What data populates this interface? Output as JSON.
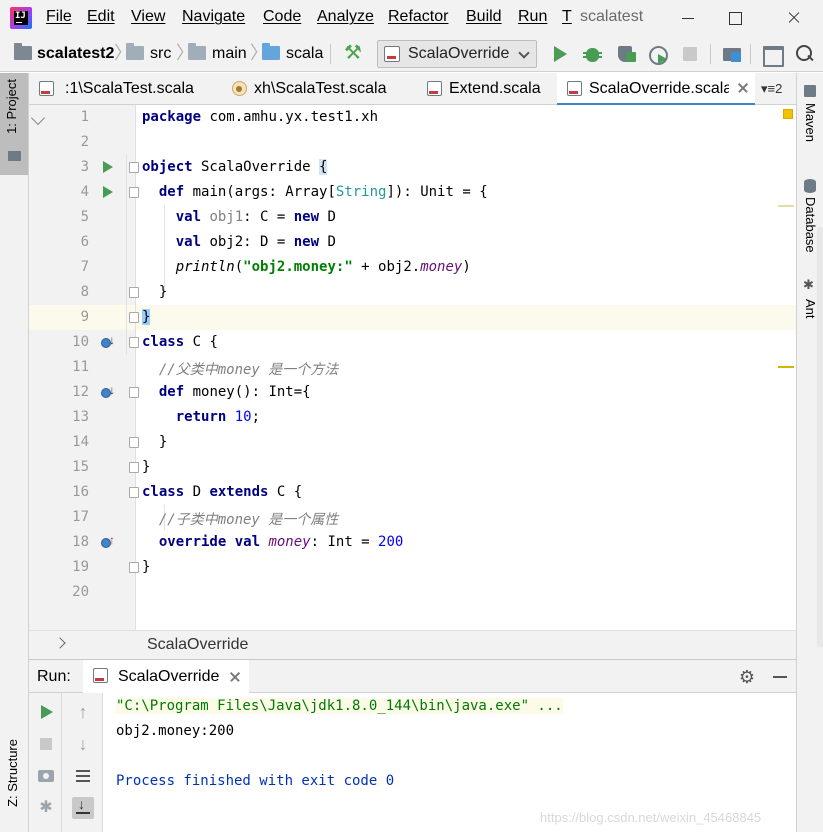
{
  "menubar": {
    "logo_text": "IJ",
    "items": [
      "File",
      "Edit",
      "View",
      "Navigate",
      "Code",
      "Analyze",
      "Refactor",
      "Build",
      "Run",
      "T"
    ],
    "window_title": "scalatest"
  },
  "navbar": {
    "breadcrumbs": [
      "scalatest2",
      "src",
      "main",
      "scala"
    ],
    "run_config": "ScalaOverride"
  },
  "left_stripe": {
    "project_label": "1: Project",
    "structure_label": "Z: Structure"
  },
  "right_stripe": {
    "tools": [
      "Maven",
      "Database",
      "Ant"
    ]
  },
  "tabs": {
    "items": [
      {
        "title": ":1\\ScalaTest.scala",
        "active": false
      },
      {
        "title": "xh\\ScalaTest.scala",
        "active": false
      },
      {
        "title": "Extend.scala",
        "active": false
      },
      {
        "title": "ScalaOverride.scala",
        "active": true
      }
    ],
    "overflow": "▾≡2"
  },
  "editor": {
    "current_line": 9,
    "lines": [
      {
        "n": "1"
      },
      {
        "n": "2"
      },
      {
        "n": "3"
      },
      {
        "n": "4"
      },
      {
        "n": "5"
      },
      {
        "n": "6"
      },
      {
        "n": "7"
      },
      {
        "n": "8"
      },
      {
        "n": "9"
      },
      {
        "n": "10"
      },
      {
        "n": "11"
      },
      {
        "n": "12"
      },
      {
        "n": "13"
      },
      {
        "n": "14"
      },
      {
        "n": "15"
      },
      {
        "n": "16"
      },
      {
        "n": "17"
      },
      {
        "n": "18"
      },
      {
        "n": "19"
      },
      {
        "n": "20"
      }
    ],
    "code": {
      "l1_kw": "package",
      "l1_rest": " com.amhu.yx.test1.xh",
      "l3_kw": "object",
      "l3_rest": " ScalaOverride ",
      "l3_brace": "{",
      "l4_indent": "  ",
      "l4_kw": "def",
      "l4_a": " main(args: Array",
      "l4_b1": "[",
      "l4_type": "String",
      "l4_b2": "]",
      "l4_c": "): Unit = {",
      "l5_indent": "    ",
      "l5_kw": "val",
      "l5_var": " obj1",
      "l5_a": ": C = ",
      "l5_kw2": "new",
      "l5_b": " D",
      "l6_indent": "    ",
      "l6_kw": "val",
      "l6_a": " obj2: D = ",
      "l6_kw2": "new",
      "l6_b": " D",
      "l7_indent": "    ",
      "l7_fn": "println",
      "l7_a": "(",
      "l7_str": "\"obj2.money:\"",
      "l7_b": " + obj2.",
      "l7_field": "money",
      "l7_c": ")",
      "l8": "  }",
      "l9": "}",
      "l10_kw": "class",
      "l10_rest": " C {",
      "l11_indent": "  ",
      "l11_cmt": "//父类中money 是一个方法",
      "l12_indent": "  ",
      "l12_kw": "def",
      "l12_rest": " money(): Int={",
      "l13_indent": "    ",
      "l13_kw": "return",
      "l13_sp": " ",
      "l13_num": "10",
      "l13_end": ";",
      "l14": "  }",
      "l15": "}",
      "l16_kw": "class",
      "l16_a": " D ",
      "l16_kw2": "extends",
      "l16_b": " C {",
      "l17_indent": "  ",
      "l17_cmt": "//子类中money 是一个属性",
      "l18_indent": "  ",
      "l18_kw": "override val",
      "l18_sp": " ",
      "l18_field": "money",
      "l18_a": ": Int = ",
      "l18_num": "200",
      "l19": "}"
    }
  },
  "breadcrumb_bar": {
    "text": "ScalaOverride"
  },
  "run_window": {
    "label": "Run:",
    "tab_title": "ScalaOverride",
    "console": {
      "command": "\"C:\\Program Files\\Java\\jdk1.8.0_144\\bin\\java.exe\" ...",
      "output": "obj2.money:200",
      "exit": "Process finished with exit code 0"
    }
  },
  "watermark": "https://blog.csdn.net/weixin_45468845",
  "colors": {
    "keyword": "#000080",
    "string": "#008000",
    "number": "#0000ff",
    "comment": "#808080",
    "field": "#660e7a",
    "accent": "#4083c9",
    "run_green": "#499c54"
  }
}
